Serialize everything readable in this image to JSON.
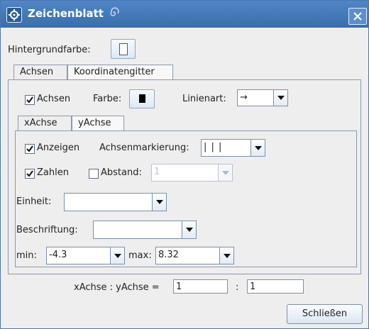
{
  "window": {
    "title": "Zeichenblatt",
    "close_symbol": "✕"
  },
  "background": {
    "label": "Hintergrundfarbe:",
    "color": "#ffffff"
  },
  "tabs": [
    {
      "label": "Achsen",
      "active": true
    },
    {
      "label": "Koordinatengitter",
      "active": false
    }
  ],
  "axes": {
    "show_label": "Achsen",
    "show_checked": true,
    "color_label": "Farbe:",
    "color": "#000000",
    "line_style_label": "Linienart:",
    "line_style_value": "→"
  },
  "axis_tabs": [
    {
      "label": "xAchse",
      "active": true
    },
    {
      "label": "yAchse",
      "active": false
    }
  ],
  "xaxis": {
    "show_label": "Anzeigen",
    "show_checked": true,
    "ticks_label": "Achsenmarkierung:",
    "ticks_value": "|   |   |",
    "numbers_label": "Zahlen",
    "numbers_checked": true,
    "distance_label": "Abstand:",
    "distance_checked": false,
    "distance_value": "1",
    "unit_label": "Einheit:",
    "unit_value": "",
    "caption_label": "Beschriftung:",
    "caption_value": "",
    "min_label": "min:",
    "min_value": "-4.3",
    "max_label": "max:",
    "max_value": "8.32"
  },
  "ratio": {
    "label": "xAchse : yAchse =",
    "x_value": "1",
    "separator": ":",
    "y_value": "1"
  },
  "close_button": "Schließen"
}
